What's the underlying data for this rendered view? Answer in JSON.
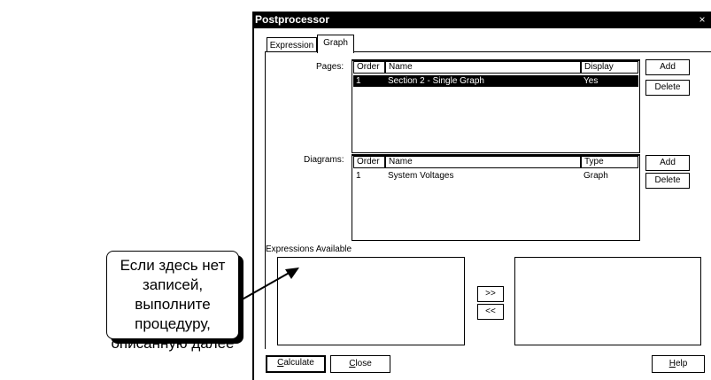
{
  "window": {
    "title": "Postprocessor",
    "close_glyph": "×"
  },
  "tabs": [
    {
      "label": "Expression",
      "active": false
    },
    {
      "label": "Graph",
      "active": true
    }
  ],
  "pages": {
    "label": "Pages:",
    "columns": [
      "Order",
      "Name",
      "Display"
    ],
    "rows": [
      {
        "order": "1",
        "name": "Section 2 - Single Graph",
        "display": "Yes",
        "selected": true
      }
    ],
    "add_label": "Add",
    "delete_label": "Delete"
  },
  "diagrams": {
    "label": "Diagrams:",
    "columns": [
      "Order",
      "Name",
      "Type"
    ],
    "rows": [
      {
        "order": "1",
        "name": "System Voltages",
        "type": "Graph",
        "selected": false
      }
    ],
    "add_label": "Add",
    "delete_label": "Delete"
  },
  "expressions": {
    "label": "Expressions Available",
    "add_arrow": ">>",
    "remove_arrow": "<<"
  },
  "footer": {
    "calculate": {
      "first": "C",
      "rest": "alculate"
    },
    "close": {
      "first": "C",
      "rest": "lose"
    },
    "help": {
      "first": "H",
      "rest": "elp"
    }
  },
  "callout": {
    "text": "Если здесь нет записей, выполните процедуру, описанную далее"
  },
  "colors": {
    "accent": "#000000",
    "background": "#ffffff"
  }
}
